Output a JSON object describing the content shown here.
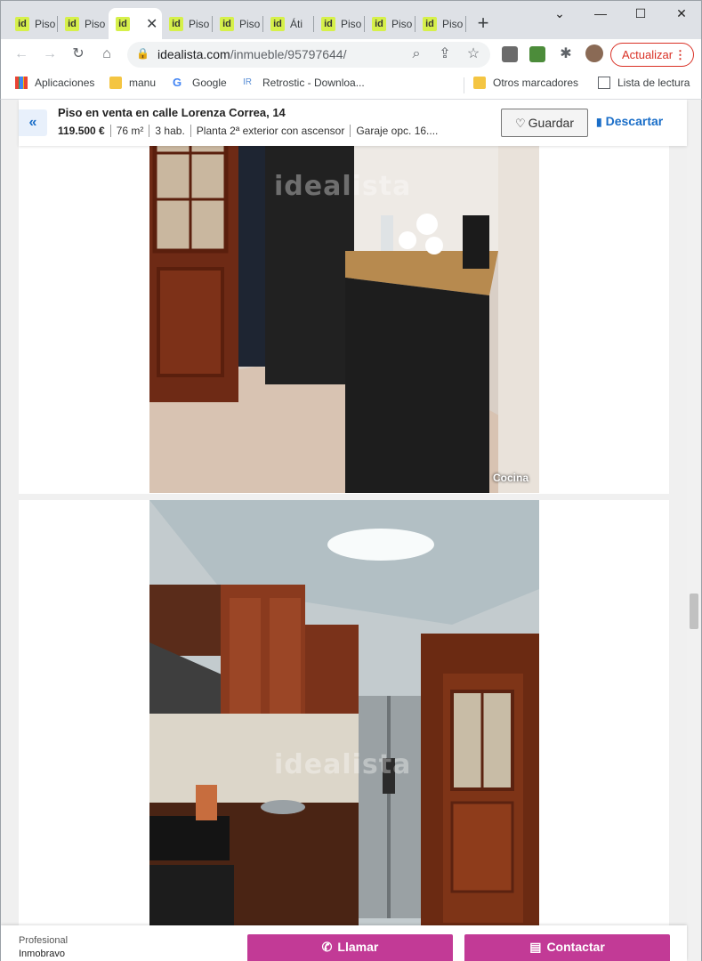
{
  "browser": {
    "tabs": [
      {
        "title": "Piso",
        "favicon": "id"
      },
      {
        "title": "Piso",
        "favicon": "id"
      },
      {
        "title": "",
        "favicon": "id",
        "active": true
      },
      {
        "title": "Piso",
        "favicon": "id"
      },
      {
        "title": "Piso",
        "favicon": "id"
      },
      {
        "title": "Áti",
        "favicon": "id"
      },
      {
        "title": "Piso",
        "favicon": "id"
      },
      {
        "title": "Piso",
        "favicon": "id"
      },
      {
        "title": "Piso",
        "favicon": "id"
      }
    ],
    "tab_close": "✕",
    "new_tab": "+",
    "window_controls": {
      "minimize": "⌄",
      "min": "—",
      "max": "☐",
      "close": "✕"
    },
    "url_host": "idealista.com",
    "url_path": "/inmueble/95797644/",
    "update_label": "Actualizar",
    "bookmarks": [
      {
        "label": "Aplicaciones",
        "icon": "apps-grid-icon"
      },
      {
        "label": "manu",
        "icon": "folder-icon"
      },
      {
        "label": "Google",
        "icon": "google-icon"
      },
      {
        "label": "Retrostic - Downloa...",
        "icon": "retrostic-icon"
      }
    ],
    "bookmarks_right": [
      {
        "label": "Otros marcadores",
        "icon": "folder-icon"
      },
      {
        "label": "Lista de lectura",
        "icon": "reading-list-icon"
      }
    ]
  },
  "listing": {
    "title": "Piso en venta en calle Lorenza Correa, 14",
    "price": "119.500 €",
    "area": "76 m²",
    "rooms": "3 hab.",
    "floor": "Planta 2ª exterior con ascensor",
    "garage": "Garaje opc. 16....",
    "save_label": "Guardar",
    "discard_label": "Descartar"
  },
  "photos": [
    {
      "caption": "Cocina",
      "watermark": "idealista"
    },
    {
      "caption": "",
      "watermark": "idealista"
    }
  ],
  "footer": {
    "professional_label": "Profesional",
    "professional_name": "Inmobravo",
    "call_label": "Llamar",
    "contact_label": "Contactar"
  },
  "colors": {
    "accent_blue": "#1a6ec8",
    "cta_magenta": "#c23a96",
    "update_red": "#d93025",
    "favicon_yellow": "#d6f04a"
  }
}
